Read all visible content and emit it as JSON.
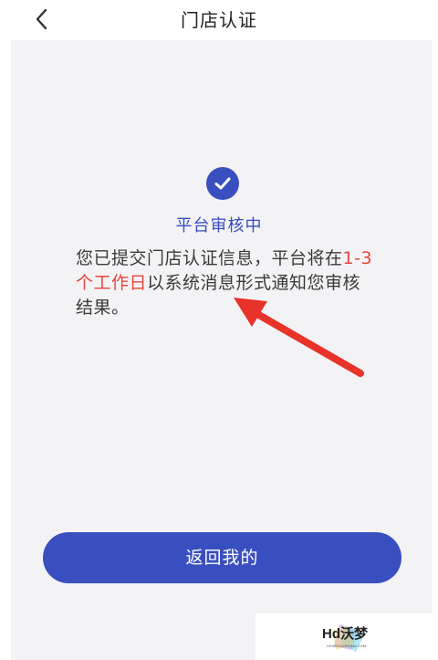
{
  "header": {
    "title": "门店认证",
    "back_icon": "chevron-left-icon"
  },
  "status": {
    "icon": "check-circle-icon",
    "title": "平台审核中",
    "message_part1": "您已提交门店认证信息，平台将在",
    "message_highlight": "1-3个工作日",
    "message_part2": "以系统消息形式通知您审核结果。"
  },
  "actions": {
    "return_label": "返回我的"
  },
  "watermark": {
    "text": "Hd沃梦",
    "sub": "HDWOODREAM.COM"
  },
  "colors": {
    "accent": "#3a4fbf",
    "highlight": "#e8453c",
    "annotation_arrow": "#e8332a",
    "panel_bg": "#f3f3f5"
  }
}
